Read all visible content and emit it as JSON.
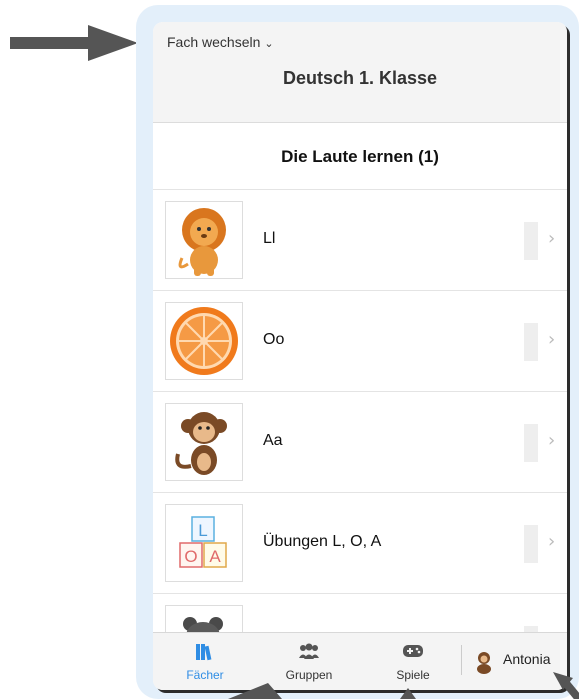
{
  "header": {
    "switch_label": "Fach wechseln",
    "subject_title": "Deutsch 1. Klasse"
  },
  "section": {
    "title": "Die Laute lernen (1)"
  },
  "lessons": [
    {
      "label": "Ll",
      "icon": "lion-icon"
    },
    {
      "label": "Oo",
      "icon": "orange-icon"
    },
    {
      "label": "Aa",
      "icon": "monkey-icon"
    },
    {
      "label": "Übungen L, O, A",
      "icon": "letter-blocks-icon"
    },
    {
      "label": "",
      "icon": "mouse-icon"
    }
  ],
  "blocks": {
    "top": "L",
    "left": "O",
    "right": "A"
  },
  "tabs": [
    {
      "label": "Fächer",
      "icon": "books-icon",
      "active": true
    },
    {
      "label": "Gruppen",
      "icon": "group-icon",
      "active": false
    },
    {
      "label": "Spiele",
      "icon": "gamepad-icon",
      "active": false
    }
  ],
  "profile": {
    "name": "Antonia",
    "icon": "avatar-icon"
  },
  "colors": {
    "accent": "#2f8de4",
    "frame": "#e3effa",
    "arrow": "#555555",
    "orange": "#f08a2c"
  }
}
